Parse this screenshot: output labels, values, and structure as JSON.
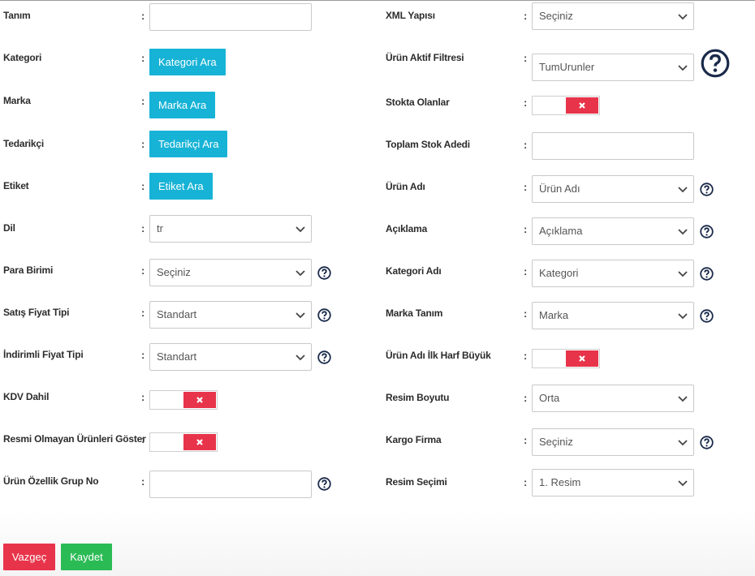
{
  "left_fields": {
    "tanim": {
      "label": "Tanım"
    },
    "kategori": {
      "label": "Kategori",
      "button": "Kategori Ara"
    },
    "marka": {
      "label": "Marka",
      "button": "Marka Ara"
    },
    "tedarikci": {
      "label": "Tedarikçi",
      "button": "Tedarikçi Ara"
    },
    "etiket": {
      "label": "Etiket",
      "button": "Etiket Ara"
    },
    "dil": {
      "label": "Dil",
      "value": "tr"
    },
    "para_birimi": {
      "label": "Para Birimi",
      "value": "Seçiniz"
    },
    "satis_fiyat_tipi": {
      "label": "Satış Fiyat Tipi",
      "value": "Standart"
    },
    "indirimli_fiyat_tipi": {
      "label": "İndirimli Fiyat Tipi",
      "value": "Standart"
    },
    "kdv_dahil": {
      "label": "KDV Dahil"
    },
    "resmi_olmayan": {
      "label": "Resmi Olmayan Ürünleri Göster"
    },
    "ozellik_grup_no": {
      "label": "Ürün Özellik Grup No"
    }
  },
  "right_fields": {
    "xml_yapisi": {
      "label": "XML Yapısı",
      "value": "Seçiniz"
    },
    "urun_aktif_filtresi": {
      "label": "Ürün Aktif Filtresi",
      "value": "TumUrunler"
    },
    "stokta_olanlar": {
      "label": "Stokta Olanlar"
    },
    "toplam_stok_adedi": {
      "label": "Toplam Stok Adedi"
    },
    "urun_adi": {
      "label": "Ürün Adı",
      "value": "Ürün Adı"
    },
    "aciklama": {
      "label": "Açıklama",
      "value": "Açıklama"
    },
    "kategori_adi": {
      "label": "Kategori Adı",
      "value": "Kategori"
    },
    "marka_tanim": {
      "label": "Marka Tanım",
      "value": "Marka"
    },
    "urun_adi_ilk_harf": {
      "label": "Ürün Adı İlk Harf Büyük"
    },
    "resim_boyutu": {
      "label": "Resim Boyutu",
      "value": "Orta"
    },
    "kargo_firma": {
      "label": "Kargo Firma",
      "value": "Seçiniz"
    },
    "resim_secimi": {
      "label": "Resim Seçimi",
      "value": "1. Resim"
    }
  },
  "colon": ":",
  "actions": {
    "cancel": "Vazgeç",
    "save": "Kaydet"
  },
  "colors": {
    "info": "#17b3d6",
    "danger": "#e8344a",
    "success": "#2bbb55",
    "help": "#1a2a4a"
  }
}
